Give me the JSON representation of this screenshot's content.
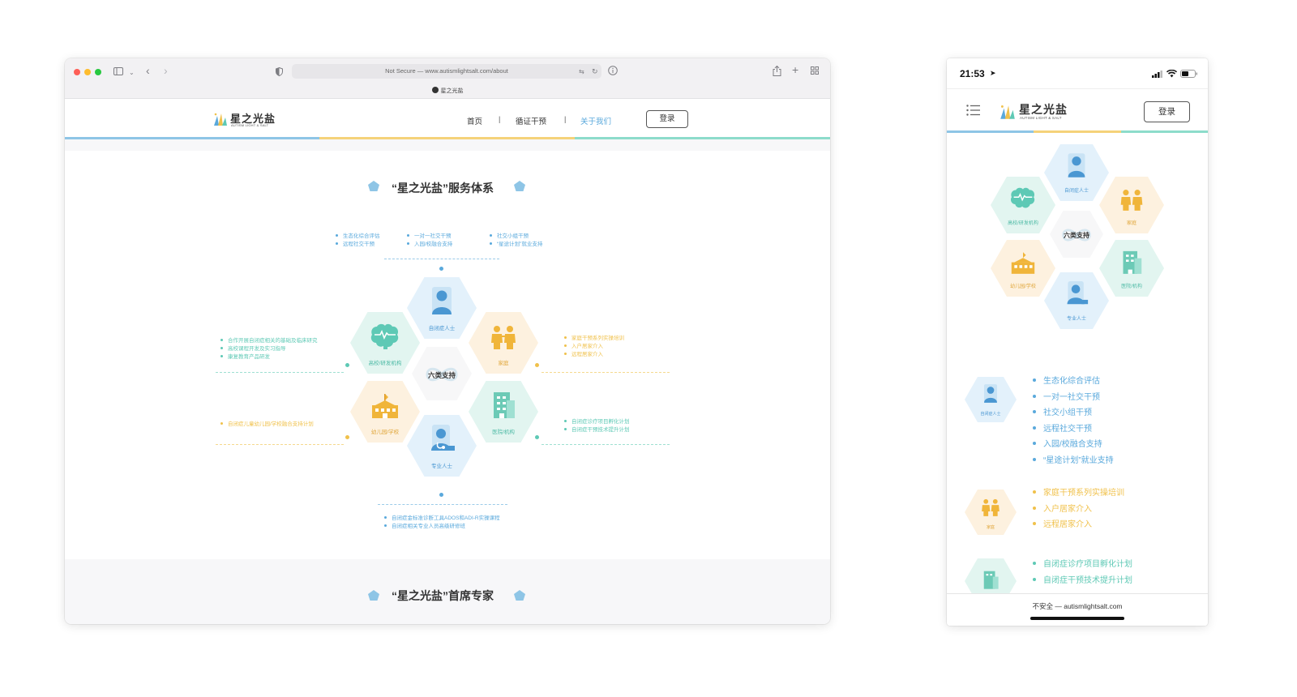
{
  "desktop": {
    "browser": {
      "url_text": "Not Secure — www.autismlightsalt.com/about",
      "tab_title": "星之光盐"
    },
    "header": {
      "logo_cn": "星之光盐",
      "logo_en": "AUTISM LIGHT & SALT",
      "nav": {
        "home": "首页",
        "separator": "|",
        "intervention": "循证干预",
        "about": "关于我们"
      },
      "login": "登录"
    },
    "section1": {
      "title": "“星之光盐”服务体系",
      "center_label": "六类支持",
      "hex_labels": {
        "autistic": "自闭症人士",
        "family": "家庭",
        "hospital": "医院/机构",
        "professional": "专业人士",
        "school": "幼儿园/学校",
        "university": "高校/研发机构"
      },
      "top_lists": [
        [
          "生态化综合评估",
          "远程社交干预"
        ],
        [
          "一对一社交干预",
          "入园/校融合支持"
        ],
        [
          "社交小组干预",
          "“星途计划”就业支持"
        ]
      ],
      "left_top_list": [
        "合作开展自闭症相关的基础及临床研究",
        "高校课程开发及实习指导",
        "康复教育产品研发"
      ],
      "left_bottom_list": [
        "自闭症儿童幼儿园/学校融合支持计划"
      ],
      "right_top_list": [
        "家庭干预系列实操培训",
        "入户居家介入",
        "远程居家介入"
      ],
      "right_bottom_list": [
        "自闭症诊疗项目孵化计划",
        "自闭症干预技术提升计划"
      ],
      "bottom_list": [
        "自闭症金标准诊断工具ADOS和ADI-R实操课程",
        "自闭症相关专业人员高级研修班"
      ]
    },
    "section2": {
      "title": "“星之光盐”首席专家"
    }
  },
  "mobile": {
    "status": {
      "time": "21:53"
    },
    "header": {
      "logo_cn": "星之光盐",
      "logo_en": "AUTISM LIGHT & SALT",
      "login": "登录"
    },
    "center_label": "六类支持",
    "hex_labels": {
      "autistic": "自闭症人士",
      "family": "家庭",
      "hospital": "医院/机构",
      "professional": "专业人士",
      "school": "幼儿园/学校",
      "university": "高校/研发机构"
    },
    "autistic_label": "自闭症人士",
    "family_label": "家庭",
    "autistic_list": [
      "生态化综合评估",
      "一对一社交干预",
      "社交小组干预",
      "远程社交干预",
      "入园/校融合支持",
      "“星途计划”就业支持"
    ],
    "family_list": [
      "家庭干预系列实操培训",
      "入户居家介入",
      "远程居家介入"
    ],
    "hospital_list": [
      "自闭症诊疗项目孵化计划",
      "自闭症干预技术提升计划"
    ],
    "url_text": "不安全 — autismlightsalt.com"
  },
  "colors": {
    "blue": "#5aa9dc",
    "yellow": "#f0c14b",
    "teal": "#5ec9b5",
    "hex_blue_bg": "#e3f1fb",
    "hex_yellow_bg": "#fdf1df",
    "hex_teal_bg": "#e2f5f0"
  }
}
